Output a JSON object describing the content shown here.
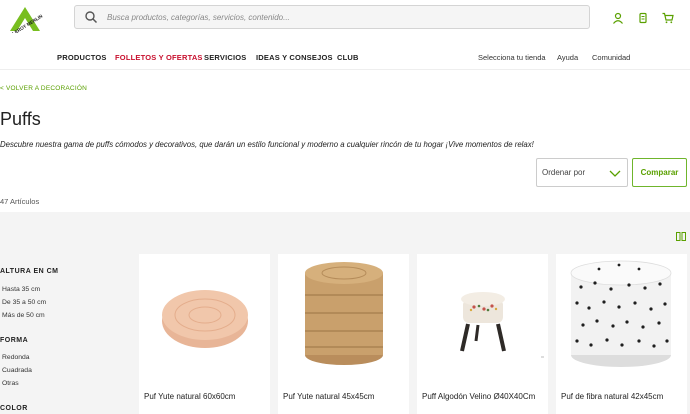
{
  "brand": {
    "logo_text": "LEROY MERLIN",
    "color": "#78be20"
  },
  "search": {
    "placeholder": "Busca productos, categorías, servicios, contenido..."
  },
  "header_icons": [
    "user-icon",
    "shopping-list-icon",
    "cart-icon"
  ],
  "nav": {
    "items": [
      {
        "label": "PRODUCTOS"
      },
      {
        "label": "FOLLETOS Y OFERTAS"
      },
      {
        "label": "SERVICIOS"
      },
      {
        "label": "IDEAS Y CONSEJOS"
      },
      {
        "label": "CLUB"
      }
    ],
    "secondary": [
      {
        "label": "Selecciona tu tienda"
      },
      {
        "label": "Ayuda"
      },
      {
        "label": "Comunidad"
      }
    ]
  },
  "back_link": "< VOLVER A DECORACIÓN",
  "page": {
    "title": "Puffs",
    "description": "Descubre nuestra gama de puffs cómodos y decorativos, que darán un estilo funcional y moderno a cualquier rincón de tu hogar ¡Vive momentos de relax!",
    "count": "47 Artículos"
  },
  "controls": {
    "sort_label": "Ordenar por",
    "compare_label": "Comparar"
  },
  "filters": [
    {
      "heading": "ALTURA EN CM",
      "options": [
        "Hasta 35 cm",
        "De 35 a 50 cm",
        "Más de 50 cm"
      ]
    },
    {
      "heading": "FORMA",
      "options": [
        "Redonda",
        "Cuadrada",
        "Otras"
      ]
    },
    {
      "heading": "COLOR",
      "options": []
    }
  ],
  "products": [
    {
      "name": "Puf Yute natural 60x60cm"
    },
    {
      "name": "Puf Yute natural 45x45cm"
    },
    {
      "name": "Puff Algodón Velino Ø40X40Cm"
    },
    {
      "name": "Puf de fibra natural 42x45cm"
    }
  ]
}
